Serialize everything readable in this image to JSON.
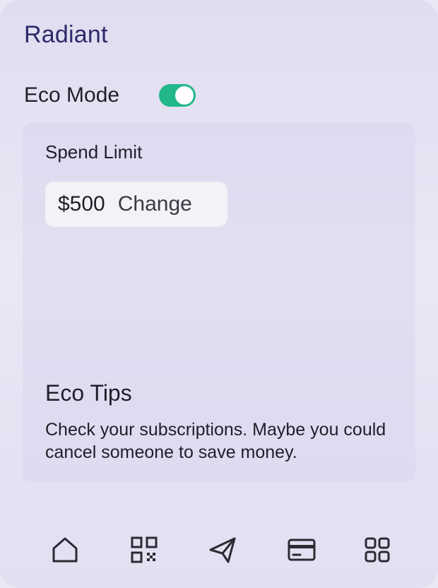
{
  "app": {
    "title": "Radiant"
  },
  "eco_mode": {
    "label": "Eco Mode",
    "enabled": true,
    "toggle_color": "#22b88a"
  },
  "spend_limit": {
    "label": "Spend Limit",
    "amount": "$500",
    "action_label": "Change"
  },
  "eco_tips": {
    "title": "Eco Tips",
    "text": "Check your subscriptions. Maybe you could cancel someone to save money."
  },
  "bottom_nav": {
    "items": [
      {
        "icon": "home-icon"
      },
      {
        "icon": "qr-code-icon"
      },
      {
        "icon": "send-icon"
      },
      {
        "icon": "card-icon"
      },
      {
        "icon": "grid-icon"
      }
    ]
  },
  "colors": {
    "title": "#2e2a6b",
    "text": "#1f1f29",
    "accent": "#22b88a"
  }
}
